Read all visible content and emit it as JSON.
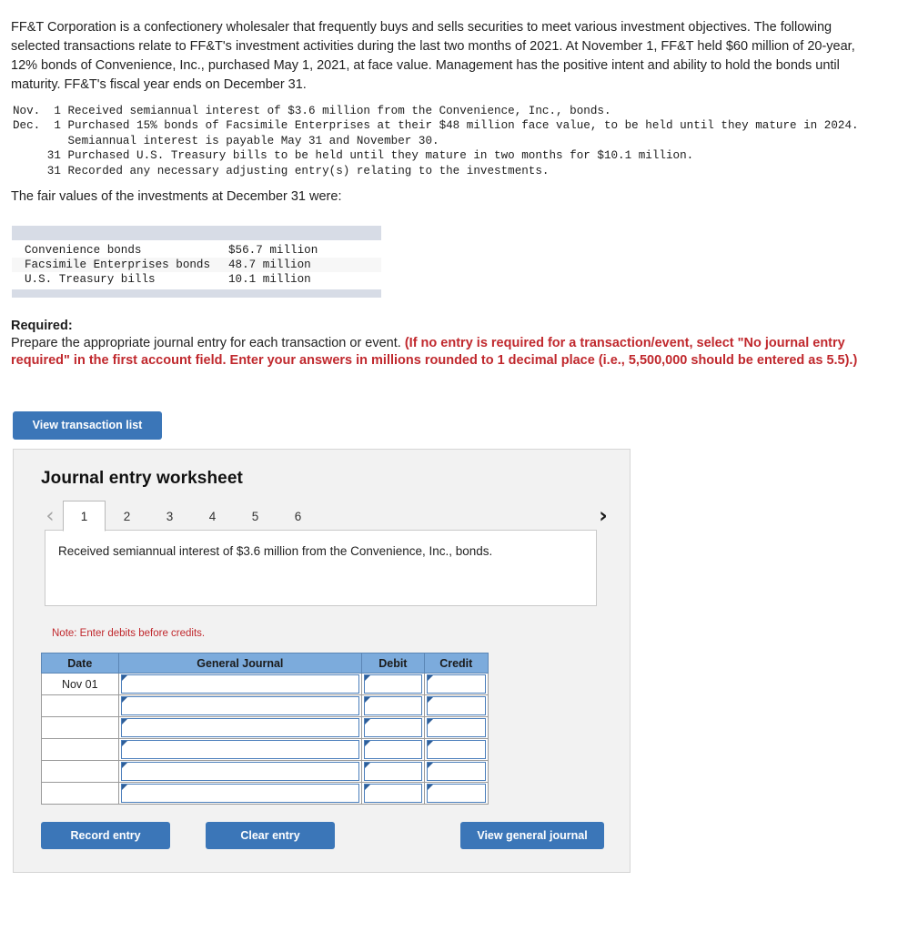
{
  "intro": {
    "paragraph": "FF&T Corporation is a confectionery wholesaler that frequently buys and sells securities to meet various investment objectives. The following selected transactions relate to FF&T's investment activities during the last two months of 2021. At November 1, FF&T held $60 million of 20-year, 12% bonds of Convenience, Inc., purchased May 1, 2021, at face value. Management has the positive intent and ability to hold the bonds until maturity. FF&T's fiscal year ends on December 31."
  },
  "transactions": {
    "text": "Nov.  1 Received semiannual interest of $3.6 million from the Convenience, Inc., bonds.\nDec.  1 Purchased 15% bonds of Facsimile Enterprises at their $48 million face value, to be held until they mature in 2024.\n        Semiannual interest is payable May 31 and November 30.\n     31 Purchased U.S. Treasury bills to be held until they mature in two months for $10.1 million.\n     31 Recorded any necessary adjusting entry(s) relating to the investments."
  },
  "fair_values": {
    "lead_in": "The fair values of the investments at December 31 were:",
    "rows": [
      {
        "name": "Convenience bonds",
        "value": "$56.7 million"
      },
      {
        "name": "Facsimile Enterprises bonds",
        "value": " 48.7 million"
      },
      {
        "name": "U.S. Treasury bills",
        "value": " 10.1 million"
      }
    ]
  },
  "required": {
    "title": "Required:",
    "black_text": "Prepare the appropriate journal entry for each transaction or event. ",
    "red_text": "(If no entry is required for a transaction/event, select \"No journal entry required\" in the first account field. Enter your answers in millions rounded to 1 decimal place (i.e., 5,500,000 should be entered as 5.5).)"
  },
  "buttons": {
    "view_transaction_list": "View transaction list",
    "record_entry": "Record entry",
    "clear_entry": "Clear entry",
    "view_general_journal": "View general journal"
  },
  "worksheet": {
    "title": "Journal entry worksheet",
    "prev_arrow": "‹",
    "next_arrow": "›",
    "tabs": [
      {
        "label": "1",
        "active": true
      },
      {
        "label": "2",
        "active": false
      },
      {
        "label": "3",
        "active": false
      },
      {
        "label": "4",
        "active": false
      },
      {
        "label": "5",
        "active": false
      },
      {
        "label": "6",
        "active": false
      }
    ],
    "description": "Received semiannual interest of $3.6 million from the Convenience, Inc., bonds.",
    "note": "Note: Enter debits before credits.",
    "table": {
      "headers": [
        "Date",
        "General Journal",
        "Debit",
        "Credit"
      ],
      "rows": [
        {
          "date": "Nov 01",
          "general_journal": "",
          "debit": "",
          "credit": ""
        },
        {
          "date": "",
          "general_journal": "",
          "debit": "",
          "credit": ""
        },
        {
          "date": "",
          "general_journal": "",
          "debit": "",
          "credit": ""
        },
        {
          "date": "",
          "general_journal": "",
          "debit": "",
          "credit": ""
        },
        {
          "date": "",
          "general_journal": "",
          "debit": "",
          "credit": ""
        },
        {
          "date": "",
          "general_journal": "",
          "debit": "",
          "credit": ""
        }
      ]
    }
  },
  "colors": {
    "button_blue": "#3b76b8",
    "table_header_blue": "#7cabdc",
    "input_border_blue": "#4a7ebb",
    "alert_red": "#c0282d",
    "panel_gray": "#f2f2f2",
    "fv_bar_gray": "#d7dce6"
  }
}
